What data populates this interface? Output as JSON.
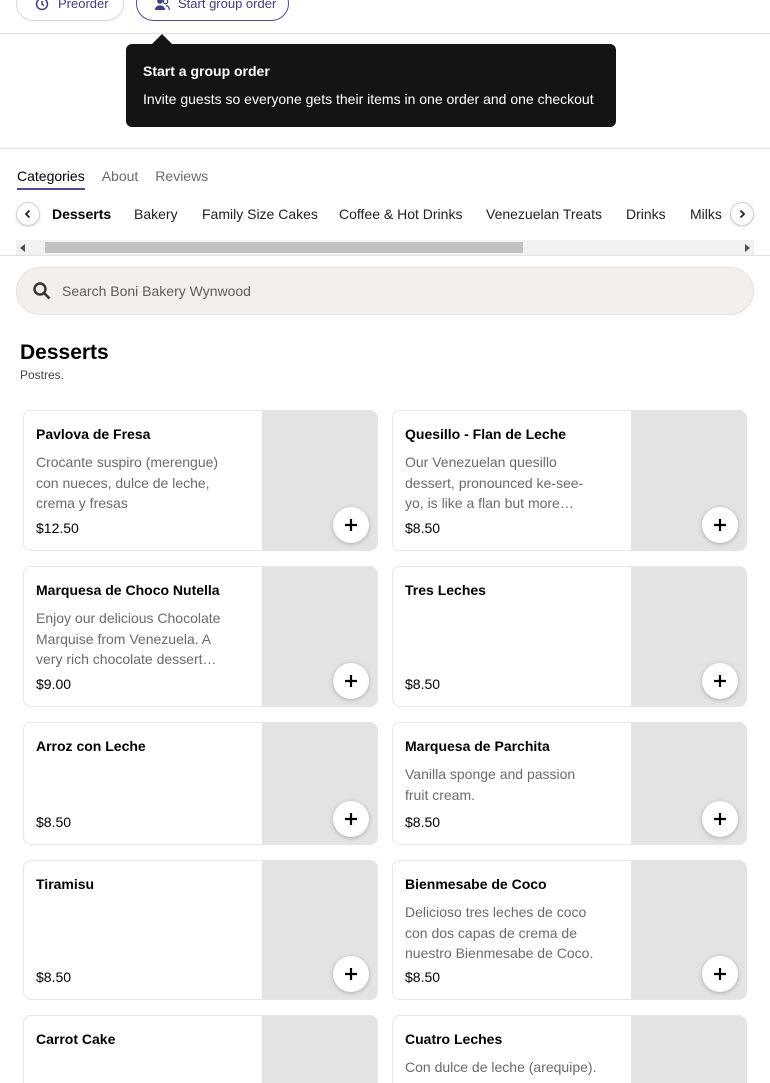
{
  "top_actions": {
    "preorder_label": "Preorder",
    "group_order_label": "Start group order"
  },
  "tooltip": {
    "title": "Start a group order",
    "body": "Invite guests so everyone gets their items in one order and one checkout"
  },
  "section_tabs": [
    {
      "label": "Categories",
      "active": true
    },
    {
      "label": "About",
      "active": false
    },
    {
      "label": "Reviews",
      "active": false
    }
  ],
  "categories": [
    {
      "label": "Desserts",
      "active": true
    },
    {
      "label": "Bakery",
      "active": false
    },
    {
      "label": "Family Size Cakes",
      "active": false
    },
    {
      "label": "Coffee & Hot Drinks",
      "active": false
    },
    {
      "label": "Venezuelan Treats",
      "active": false
    },
    {
      "label": "Drinks",
      "active": false
    },
    {
      "label": "Milks",
      "active": false
    }
  ],
  "search": {
    "placeholder": "Search Boni Bakery Wynwood",
    "value": ""
  },
  "section": {
    "title": "Desserts",
    "subtitle": "Postres."
  },
  "items": [
    {
      "name": "Pavlova de Fresa",
      "description": "Crocante suspiro (merengue) con nueces, dulce de leche, crema y fresas",
      "price": "$12.50"
    },
    {
      "name": "Quesillo - Flan de Leche",
      "description": "Our Venezuelan quesillo dessert, pronounced ke-see-yo, is like a flan but more delicious.",
      "price": "$8.50"
    },
    {
      "name": "Marquesa de Choco Nutella",
      "description": "Enjoy our delicious Chocolate Marquise from Venezuela. A very rich chocolate dessert made of layers of cookies and Nutella.",
      "price": "$9.00"
    },
    {
      "name": "Tres Leches",
      "description": "",
      "price": "$8.50"
    },
    {
      "name": "Arroz con Leche",
      "description": "",
      "price": "$8.50"
    },
    {
      "name": "Marquesa de Parchita",
      "description": "Vanilla sponge and passion fruit cream.",
      "price": "$8.50"
    },
    {
      "name": "Tiramisu",
      "description": "",
      "price": "$8.50"
    },
    {
      "name": "Bienmesabe de Coco",
      "description": "Delicioso tres leches de coco con dos capas de crema de nuestro Bienmesabe de Coco.",
      "price": "$8.50"
    },
    {
      "name": "Carrot Cake",
      "description": "",
      "price": ""
    },
    {
      "name": "Cuatro Leches",
      "description": "Con dulce de leche (arequipe).",
      "price": ""
    }
  ],
  "colors": {
    "accent": "#4b4b9c",
    "tooltip_bg": "#141414",
    "search_bg": "#f3efec",
    "image_placeholder": "#e3e3e3"
  }
}
